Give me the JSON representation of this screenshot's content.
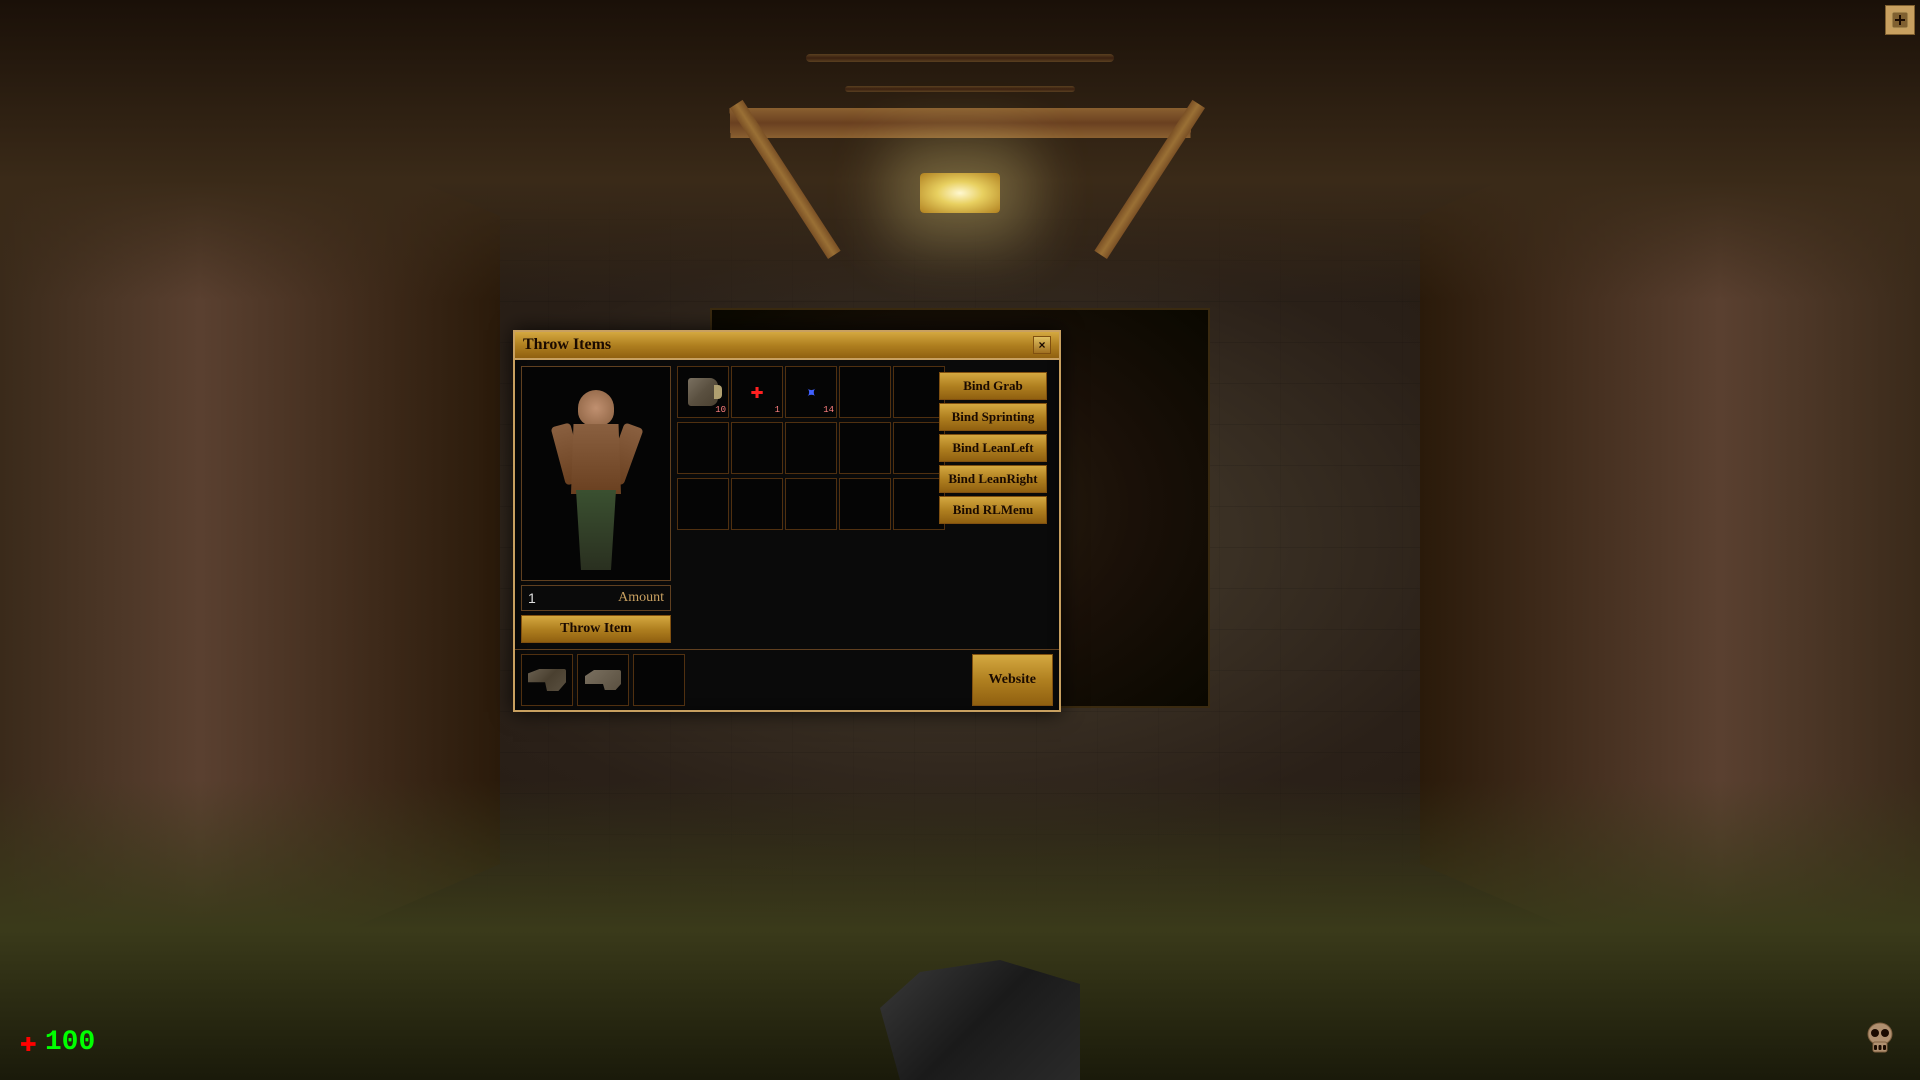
{
  "game": {
    "title": "Throw Items",
    "close_label": "×"
  },
  "hud": {
    "health_value": "100",
    "health_icon": "✚",
    "skull_icon": "💀"
  },
  "dialog": {
    "title": "Throw Items",
    "close_label": "×",
    "amount_value": "1",
    "amount_label": "Amount",
    "throw_item_label": "Throw Item",
    "website_label": "Website",
    "buttons": [
      {
        "id": "bind-grab",
        "label": "Bind Grab"
      },
      {
        "id": "bind-sprinting",
        "label": "Bind Sprinting"
      },
      {
        "id": "bind-leanleft",
        "label": "Bind LeanLeft"
      },
      {
        "id": "bind-leanright",
        "label": "Bind LeanRight"
      },
      {
        "id": "bind-rlmenu",
        "label": "Bind RLMenu"
      }
    ],
    "inventory_rows": [
      [
        {
          "has_item": true,
          "type": "flashlight"
        },
        {
          "has_item": true,
          "type": "medkit"
        },
        {
          "has_item": true,
          "type": "tool"
        },
        {
          "has_item": false
        },
        {
          "has_item": false
        }
      ],
      [
        {
          "has_item": false
        },
        {
          "has_item": false
        },
        {
          "has_item": false
        },
        {
          "has_item": false
        },
        {
          "has_item": false
        }
      ],
      [
        {
          "has_item": false
        },
        {
          "has_item": false
        },
        {
          "has_item": false
        },
        {
          "has_item": false
        },
        {
          "has_item": false
        }
      ]
    ],
    "bottom_items": [
      {
        "has_item": true,
        "type": "gun1"
      },
      {
        "has_item": true,
        "type": "gun2"
      },
      {
        "has_item": false
      }
    ]
  }
}
